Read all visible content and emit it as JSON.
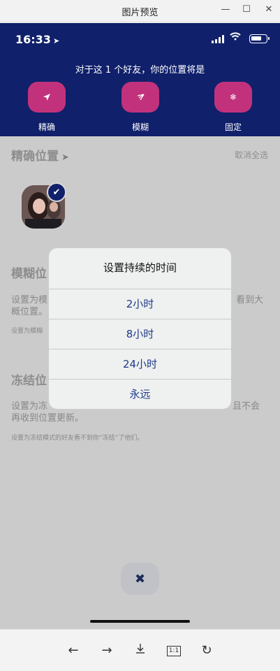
{
  "window": {
    "title": "图片预览"
  },
  "status_bar": {
    "time": "16:33",
    "location_glyph": "➤"
  },
  "header": {
    "prompt": "对于这 1 个好友，你的位置将是",
    "modes": [
      {
        "label": "精确",
        "icon": "navigation-arrow-icon"
      },
      {
        "label": "模糊",
        "icon": "fuzzy-arrow-icon"
      },
      {
        "label": "固定",
        "icon": "snowflake-icon"
      }
    ]
  },
  "content": {
    "precise": {
      "title": "精确位置",
      "action": "取消全选",
      "selected_friends": 1
    },
    "fuzzy": {
      "title": "模糊位",
      "desc_left": "设置为模",
      "desc_right": "看到大",
      "desc_line2": "概位置。",
      "note": "设置为模糊"
    },
    "freeze": {
      "title": "冻结位",
      "desc_left": "设置为冻",
      "desc_right": "且不会",
      "desc_line2": "再收到位置更新。",
      "note": "设置为冻结模式的好友看不到你“冻结”了他们。"
    }
  },
  "dialog": {
    "title": "设置持续的时间",
    "options": [
      "2小时",
      "8小时",
      "24小时",
      "永远"
    ]
  },
  "toolbar": {
    "actual_size_label": "1:1"
  },
  "colors": {
    "header_bg": "#10206b",
    "mode_button": "#c2327c",
    "dialog_option_text": "#1e3a8a"
  }
}
